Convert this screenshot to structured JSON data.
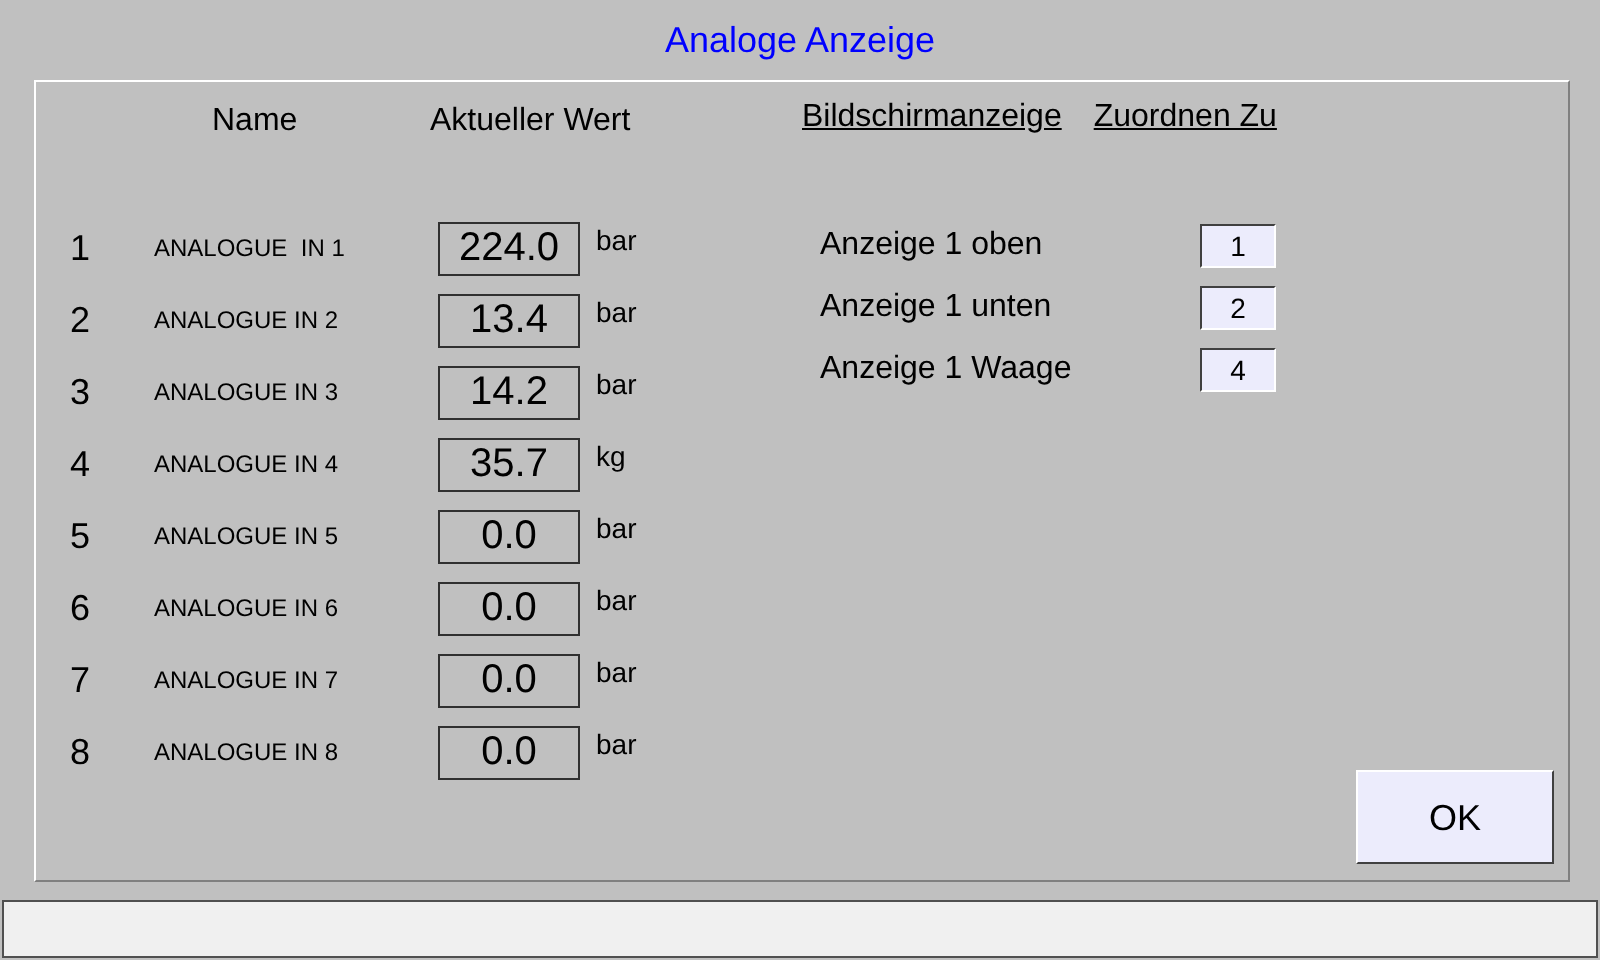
{
  "window": {
    "title": "Analoge Anzeige"
  },
  "inputs": {
    "columns": [
      "Name",
      "Aktueller Wert"
    ],
    "rows": [
      {
        "number": "1",
        "name": "ANALOGUE  IN 1",
        "value": "224.0",
        "unit": "bar"
      },
      {
        "number": "2",
        "name": "ANALOGUE IN 2",
        "value": "13.4",
        "unit": "bar"
      },
      {
        "number": "3",
        "name": "ANALOGUE IN 3",
        "value": "14.2",
        "unit": "bar"
      },
      {
        "number": "4",
        "name": "ANALOGUE IN 4",
        "value": "35.7",
        "unit": "kg"
      },
      {
        "number": "5",
        "name": "ANALOGUE IN 5",
        "value": "0.0",
        "unit": "bar"
      },
      {
        "number": "6",
        "name": "ANALOGUE IN 6",
        "value": "0.0",
        "unit": "bar"
      },
      {
        "number": "7",
        "name": "ANALOGUE IN 7",
        "value": "0.0",
        "unit": "bar"
      },
      {
        "number": "8",
        "name": "ANALOGUE IN 8",
        "value": "0.0",
        "unit": "bar"
      }
    ]
  },
  "assignments": {
    "columns": [
      "Bildschirmanzeige",
      "Zuordnen Zu"
    ],
    "rows": [
      {
        "label": "Anzeige 1 oben",
        "value": "1"
      },
      {
        "label": "Anzeige 1 unten",
        "value": "2"
      },
      {
        "label": "Anzeige 1 Waage",
        "value": "4"
      }
    ]
  },
  "buttons": [
    "OK"
  ]
}
